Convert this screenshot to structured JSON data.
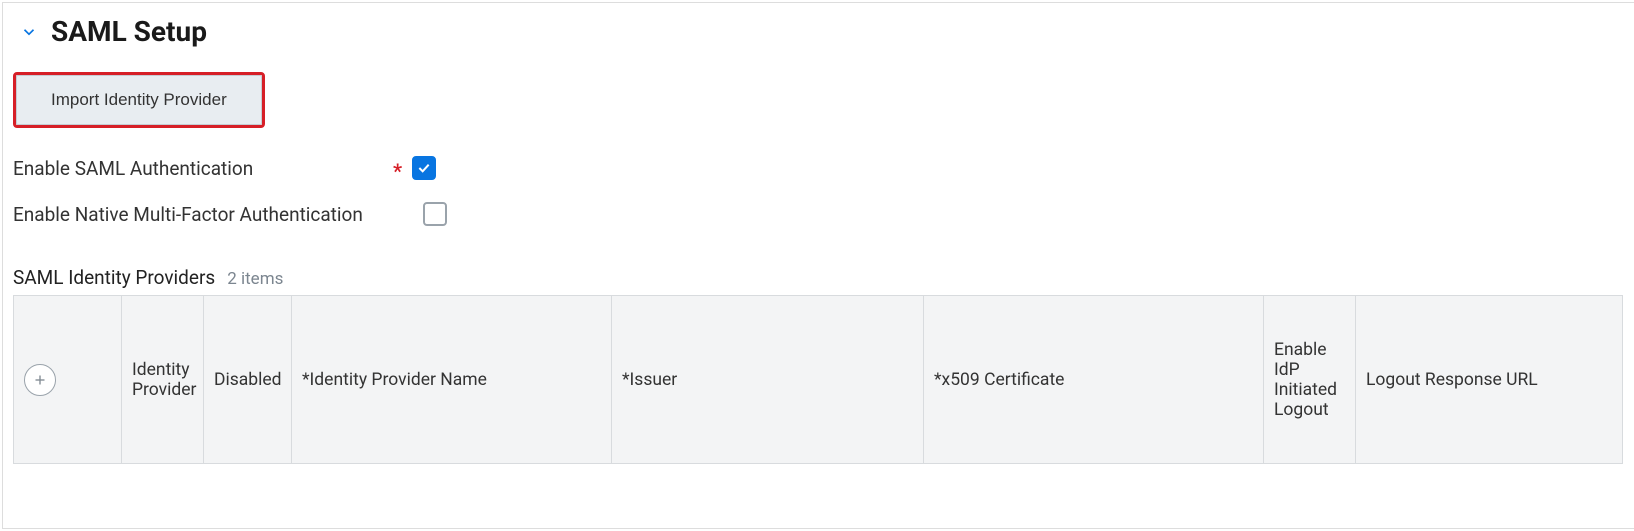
{
  "section": {
    "title": "SAML Setup"
  },
  "actions": {
    "import_idp_label": "Import Identity Provider"
  },
  "fields": {
    "enable_saml": {
      "label": "Enable SAML Authentication",
      "required": true,
      "checked": true
    },
    "enable_mfa": {
      "label": "Enable Native Multi-Factor Authentication",
      "required": false,
      "checked": false
    }
  },
  "table": {
    "title": "SAML Identity Providers",
    "count_label": "2 items",
    "columns": {
      "idp": "Identity Provider",
      "disabled": "Disabled",
      "name": "*Identity Provider Name",
      "issuer": "*Issuer",
      "cert": "*x509 Certificate",
      "idp_logout": "Enable IdP Initiated Logout",
      "logout_url": "Logout Response URL"
    }
  }
}
